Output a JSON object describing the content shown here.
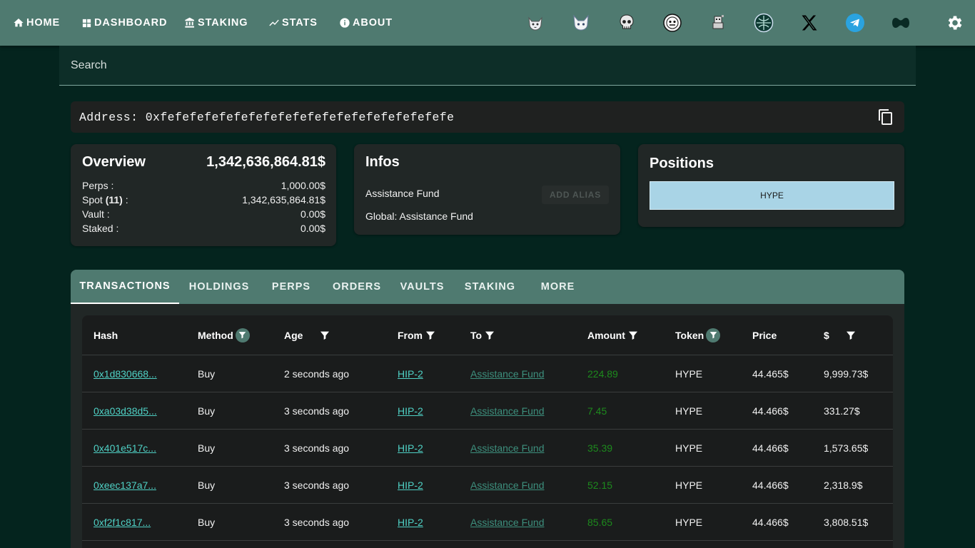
{
  "nav": {
    "items": [
      {
        "label": "HOME",
        "icon": "home-icon"
      },
      {
        "label": "DASHBOARD",
        "icon": "dashboard-icon"
      },
      {
        "label": "STAKING",
        "icon": "bank-icon"
      },
      {
        "label": "STATS",
        "icon": "trending-icon"
      },
      {
        "label": "ABOUT",
        "icon": "info-icon"
      }
    ],
    "socials": [
      "cat-mascot-icon",
      "fox-mascot-icon",
      "skull-icon",
      "masked-face-icon",
      "pixel-creature-icon",
      "hyperliquid-logo-icon",
      "x-logo-icon",
      "telegram-icon",
      "hyperliquid-wave-icon"
    ],
    "settings_icon": "gear-icon"
  },
  "search": {
    "placeholder": "Search"
  },
  "address": {
    "label": "Address:",
    "value": "0xfefefefefefefefefefefefefefefefefefefefe"
  },
  "overview": {
    "title": "Overview",
    "total": "1,342,636,864.81$",
    "rows": [
      {
        "label": "Perps :",
        "value": "1,000.00$"
      },
      {
        "label": "Spot",
        "count": "(11)",
        "suffix": " :",
        "value": "1,342,635,864.81$"
      },
      {
        "label": "Vault :",
        "value": "0.00$"
      },
      {
        "label": "Staked :",
        "value": "0.00$"
      }
    ]
  },
  "infos": {
    "title": "Infos",
    "name": "Assistance Fund",
    "add_alias": "ADD ALIAS",
    "global": "Global: Assistance Fund"
  },
  "positions": {
    "title": "Positions",
    "items": [
      "HYPE"
    ]
  },
  "tabs": [
    "TRANSACTIONS",
    "HOLDINGS",
    "PERPS",
    "ORDERS",
    "VAULTS",
    "STAKING",
    "MORE"
  ],
  "active_tab": "TRANSACTIONS",
  "table": {
    "headers": [
      "Hash",
      "Method",
      "Age",
      "From",
      "To",
      "Amount",
      "Token",
      "Price",
      "$"
    ],
    "rows": [
      {
        "hash": "0x1d830668...",
        "method": "Buy",
        "age": "2 seconds ago",
        "from": "HIP-2",
        "to": "Assistance Fund",
        "amount": "224.89",
        "token": "HYPE",
        "price": "44.465$",
        "usd": "9,999.73$"
      },
      {
        "hash": "0xa03d38d5...",
        "method": "Buy",
        "age": "3 seconds ago",
        "from": "HIP-2",
        "to": "Assistance Fund",
        "amount": "7.45",
        "token": "HYPE",
        "price": "44.466$",
        "usd": "331.27$"
      },
      {
        "hash": "0x401e517c...",
        "method": "Buy",
        "age": "3 seconds ago",
        "from": "HIP-2",
        "to": "Assistance Fund",
        "amount": "35.39",
        "token": "HYPE",
        "price": "44.466$",
        "usd": "1,573.65$"
      },
      {
        "hash": "0xeec137a7...",
        "method": "Buy",
        "age": "3 seconds ago",
        "from": "HIP-2",
        "to": "Assistance Fund",
        "amount": "52.15",
        "token": "HYPE",
        "price": "44.466$",
        "usd": "2,318.9$"
      },
      {
        "hash": "0xf2f1c817...",
        "method": "Buy",
        "age": "3 seconds ago",
        "from": "HIP-2",
        "to": "Assistance Fund",
        "amount": "85.65",
        "token": "HYPE",
        "price": "44.466$",
        "usd": "3,808.51$"
      }
    ]
  },
  "colors": {
    "nav_bg": "#4f7a70",
    "page_bg": "#04241e",
    "card_bg": "#212726",
    "link": "#4fd1c5",
    "amount": "#1d8a1d",
    "position_bar": "#a9d4e6"
  }
}
